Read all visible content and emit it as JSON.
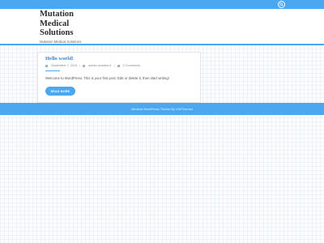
{
  "site": {
    "title": "Mutation Medical Solutions",
    "tagline": "Mutation Medical Solutions"
  },
  "topbar": {
    "search_icon": "search-icon",
    "color": "#4aa7f0"
  },
  "post": {
    "title": "Hello world!",
    "date": "September 7, 2019",
    "author": "admin-mutation1",
    "comments": "0 Comments",
    "excerpt": "Welcome to WordPress. This is your first post. Edit or delete it, then start writing!",
    "read_more": "READ MORE"
  },
  "footer": {
    "text": "Medical WordPress Theme By VWThemes"
  }
}
